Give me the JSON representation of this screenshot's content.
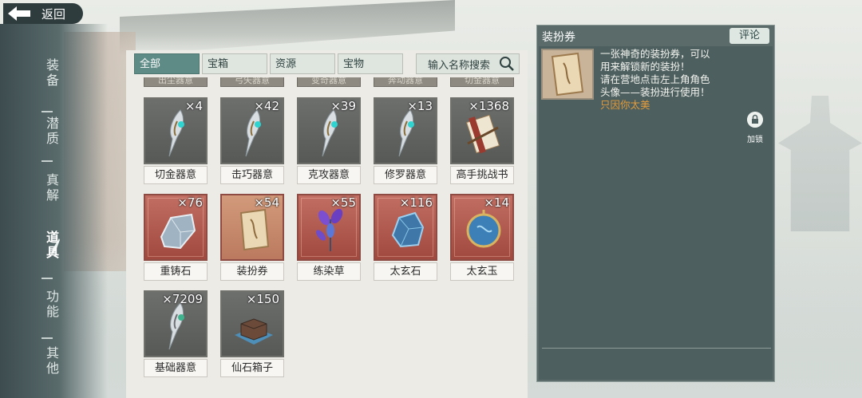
{
  "header": {
    "back_label": "返回"
  },
  "left_nav": {
    "items": [
      {
        "label": "装备",
        "active": false
      },
      {
        "label": "潜质",
        "active": false
      },
      {
        "label": "真解",
        "active": false
      },
      {
        "label": "道具",
        "active": true
      },
      {
        "label": "功能",
        "active": false
      },
      {
        "label": "其他",
        "active": false
      }
    ]
  },
  "inventory": {
    "tabs": [
      {
        "label": "全部",
        "active": true
      },
      {
        "label": "宝箱",
        "active": false
      },
      {
        "label": "资源",
        "active": false
      },
      {
        "label": "宝物",
        "active": false
      }
    ],
    "search_placeholder": "输入名称搜索",
    "cut_row": [
      "出尘器意",
      "弓矢器意",
      "变奇器意",
      "奔动器意",
      "切金器意"
    ],
    "items": [
      {
        "name": "切金器意",
        "count": "×4",
        "rarity": "gray",
        "icon": "spirit-blade-icon"
      },
      {
        "name": "击巧器意",
        "count": "×42",
        "rarity": "gray",
        "icon": "spirit-blade-icon"
      },
      {
        "name": "克攻器意",
        "count": "×39",
        "rarity": "gray",
        "icon": "spirit-blade-icon"
      },
      {
        "name": "修罗器意",
        "count": "×13",
        "rarity": "gray",
        "icon": "spirit-blade-icon"
      },
      {
        "name": "高手挑战书",
        "count": "×1368",
        "rarity": "gray",
        "icon": "challenge-scroll-icon"
      },
      {
        "name": "重铸石",
        "count": "×76",
        "rarity": "red",
        "icon": "reforge-stone-icon"
      },
      {
        "name": "装扮券",
        "count": "×54",
        "rarity": "gold",
        "icon": "costume-ticket-icon"
      },
      {
        "name": "练染草",
        "count": "×55",
        "rarity": "red",
        "icon": "dye-herb-icon"
      },
      {
        "name": "太玄石",
        "count": "×116",
        "rarity": "red",
        "icon": "taixuan-stone-icon"
      },
      {
        "name": "太玄玉",
        "count": "×14",
        "rarity": "red",
        "icon": "taixuan-jade-icon"
      },
      {
        "name": "基础器意",
        "count": "×7209",
        "rarity": "gray",
        "icon": "spirit-blade-icon"
      },
      {
        "name": "仙石箱子",
        "count": "×150",
        "rarity": "gray",
        "icon": "stone-chest-icon"
      }
    ]
  },
  "detail": {
    "title": "装扮券",
    "comment_label": "评论",
    "description_lines": [
      "一张神奇的装扮券，可以",
      "用来解锁新的装扮！",
      "请在营地点击左上角角色",
      "头像——装扮进行使用！"
    ],
    "flavor": "只因你太美",
    "lock_label": "加锁",
    "flavor_color": "#e29b3c"
  }
}
